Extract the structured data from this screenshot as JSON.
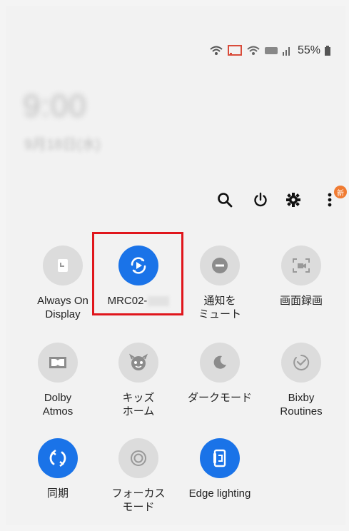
{
  "status": {
    "battery": "55%"
  },
  "lock": {
    "time": "9:00",
    "date": "9月18日(水)"
  },
  "actions": {
    "new_badge": "新"
  },
  "tiles": [
    {
      "label": "Always On\nDisplay"
    },
    {
      "label": "MRC02-"
    },
    {
      "label": "通知を\nミュート"
    },
    {
      "label": "画面録画"
    },
    {
      "label": "Dolby\nAtmos"
    },
    {
      "label": "キッズ\nホーム"
    },
    {
      "label": "ダークモード"
    },
    {
      "label": "Bixby\nRoutines"
    },
    {
      "label": "同期"
    },
    {
      "label": "フォーカス\nモード"
    },
    {
      "label": "Edge lighting"
    }
  ],
  "colors": {
    "active": "#1a73e8",
    "inactive": "#dcdcdc",
    "highlight": "#e0161c",
    "badge": "#f07b32"
  }
}
